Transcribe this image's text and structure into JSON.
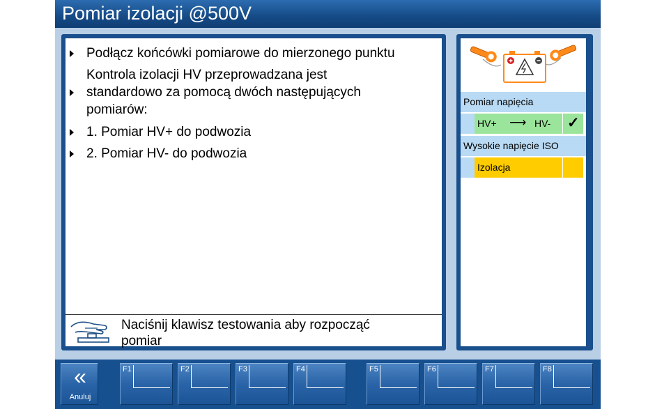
{
  "window": {
    "title": "Pomiar izolacji @500V"
  },
  "instructions": [
    {
      "lines": [
        "Podłącz końcówki pomiarowe do mierzonego punktu"
      ]
    },
    {
      "lines": [
        "Kontrola izolacji HV przeprowadzana jest",
        "standardowo za pomocą dwóch następujących",
        "pomiarów:"
      ]
    },
    {
      "lines": [
        "1. Pomiar HV+ do podwozia"
      ]
    },
    {
      "lines": [
        "2. Pomiar HV- do podwozia"
      ]
    }
  ],
  "hint": {
    "icon": "hand-press-button-icon",
    "lines": [
      "Naciśnij klawisz testowania aby rozpocząć",
      "pomiar"
    ]
  },
  "sidebar": {
    "icon": "battery-probes-icon",
    "voltage": {
      "label": "Pomiar napięcia",
      "from": "HV+",
      "arrow": "⟶",
      "to": "HV-",
      "status": "✓"
    },
    "iso": {
      "label": "Wysokie napięcie ISO",
      "value": "Izolacja"
    }
  },
  "fkeys": {
    "cancel": {
      "symbol": "«",
      "label": "Anuluj"
    },
    "keys": [
      "F1",
      "F2",
      "F3",
      "F4",
      "F5",
      "F6",
      "F7",
      "F8"
    ]
  },
  "colors": {
    "frame": "#16508f",
    "workarea": "#b9cfe6",
    "row_header": "#b9daf4",
    "status_ok": "#9be49b",
    "status_pending": "#ffcc00"
  }
}
